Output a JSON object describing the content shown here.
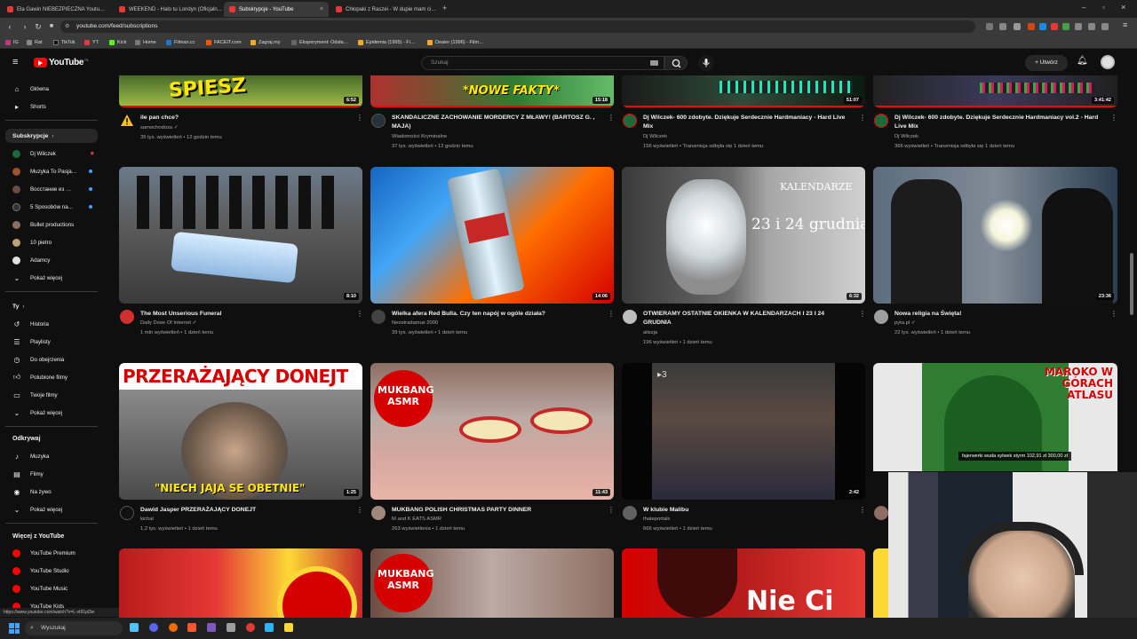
{
  "browser": {
    "tabs": [
      {
        "title": "Ela Gawin NIEBEZPIECZNA Youtu…"
      },
      {
        "title": "WEEKEND - Halo tu Londyn (Oficjaln…"
      },
      {
        "title": "Subskrypcje - YouTube",
        "close": "×"
      },
      {
        "title": "Chłopaki z Raszei - W dupie mam ci…"
      }
    ],
    "new_tab": "+",
    "url": "youtube.com/feed/subscriptions",
    "bookmarks": [
      "IG",
      "Rat",
      "TikTok",
      "YT",
      "Kick",
      "Home",
      "Filman.cc",
      "FACEIT.com",
      "Zagraj.my",
      "Eksperyment: Odsła…",
      "Epidemia (1995) - Fi…",
      "Dealer (1996) - Film…"
    ]
  },
  "youtube": {
    "logo_text": "YouTube",
    "logo_region": "PL",
    "search_placeholder": "Szukaj",
    "create_label": "Utwórz"
  },
  "sidebar": {
    "main": [
      {
        "label": "Główna",
        "icon": "home-icon"
      },
      {
        "label": "Shorts",
        "icon": "shorts-icon"
      }
    ],
    "subscriptions_header": "Subskrypcje",
    "subscriptions": [
      {
        "label": "Dj Wilczek",
        "color": "#1b6b3a",
        "live": true
      },
      {
        "label": "Muzyka To Pasja…",
        "color": "#a0522d"
      },
      {
        "label": "Восстание из …",
        "color": "#6d4c41"
      },
      {
        "label": "5 Sposobów na…",
        "color": "#303030",
        "dot": true
      },
      {
        "label": "Bullet productions",
        "color": "#8d6e63"
      },
      {
        "label": "10 pietro",
        "color": "#c0a070"
      },
      {
        "label": "Adamcy",
        "color": "#e0e0e0"
      },
      {
        "label": "Pokaż więcej",
        "icon": "chevron-down-icon"
      }
    ],
    "you_header": "Ty",
    "you": [
      {
        "label": "Historia",
        "icon": "history-icon"
      },
      {
        "label": "Playlisty",
        "icon": "playlist-icon"
      },
      {
        "label": "Do obejrzenia",
        "icon": "clock-icon"
      },
      {
        "label": "Polubione filmy",
        "icon": "thumbs-up-icon"
      },
      {
        "label": "Twoje filmy",
        "icon": "video-icon"
      },
      {
        "label": "Pokaż więcej",
        "icon": "chevron-down-icon"
      }
    ],
    "explore_header": "Odkrywaj",
    "explore": [
      {
        "label": "Muzyka",
        "icon": "music-icon"
      },
      {
        "label": "Filmy",
        "icon": "film-icon"
      },
      {
        "label": "Na żywo",
        "icon": "live-icon"
      },
      {
        "label": "Pokaż więcej",
        "icon": "chevron-down-icon"
      }
    ],
    "more_header": "Więcej z YouTube",
    "more": [
      {
        "label": "YouTube Premium"
      },
      {
        "label": "YouTube Studio"
      },
      {
        "label": "YouTube Music"
      },
      {
        "label": "YouTube Kids"
      }
    ]
  },
  "videos": [
    {
      "title": "ile pan chce?",
      "channel": "samochodoza",
      "meta": "35 tys. wyświetleń • 12 godzin temu",
      "duration": "6:52",
      "overlay": "SPIESZ",
      "verified": true
    },
    {
      "title": "SKANDALICZNE ZACHOWANIE MORDERCY Z MŁAWY! (BARTOSZ G. , MAJA)",
      "channel": "Wiadomości Kryminalne",
      "meta": "37 tys. wyświetleń • 12 godzin temu",
      "duration": "15:18",
      "overlay": "*NOWE FAKTY*"
    },
    {
      "title": "Dj Wilczek- 600 zdobyte. Dziękuje Serdecznie Hardmaniacy - Hard Live Mix",
      "channel": "Dj Wilczek",
      "meta": "156 wyświetleń • Transmisja odbyła się 1 dzień temu",
      "duration": "51:07"
    },
    {
      "title": "Dj Wilczek- 600 zdobyte. Dziękuje Serdecznie Hardmaniacy vol.2 - Hard Live Mix",
      "channel": "Dj Wilczek",
      "meta": "366 wyświetleń • Transmisja odbyła się 1 dzień temu",
      "duration": "3:41:42"
    },
    {
      "title": "The Most Unserious Funeral",
      "channel": "Daily Dose Of Internet",
      "meta": "1 mln wyświetleń • 1 dzień temu",
      "duration": "8:10",
      "verified": true
    },
    {
      "title": "Wielka afera Red Bulla. Czy ten napój w ogóle działa?",
      "channel": "Neostradamus 2000",
      "meta": "39 tys. wyświetleń • 1 dzień temu",
      "duration": "14:06"
    },
    {
      "title": "OTWIERAMY OSTATNIE OKIENKA W KALENDARZACH I 23 I 24 GRUDNIA",
      "channel": "aliszja",
      "meta": "196 wyświetleń • 1 dzień temu",
      "duration": "6:32",
      "overlay": "KALENDARZE",
      "overlay2": "23 i 24 grudnia"
    },
    {
      "title": "Nowa religia na Święta!",
      "channel": "pyta.pl",
      "meta": "22 tys. wyświetleń • 1 dzień temu",
      "duration": "23:36",
      "verified": true
    },
    {
      "title": "Dawid Jasper PRZERAŻAJĄCY DONEJT",
      "channel": "kichal",
      "meta": "1,2 tys. wyświetleń • 1 dzień temu",
      "duration": "1:25",
      "overlay": "PRZERAŻAJĄCY DONEJT",
      "overlay2": "\"NIECH JAJA SE OBETNIE\""
    },
    {
      "title": "MUKBANG POLISH CHRISTMAS PARTY DINNER",
      "channel": "M and K EATS ASMR",
      "meta": "263 wyświetlenia • 1 dzień temu",
      "duration": "11:43",
      "overlay": "MUKBANG ASMR"
    },
    {
      "title": "W klubie Malibu",
      "channel": "thateportals",
      "meta": "666 wyświetleń • 1 dzień temu",
      "duration": "2:42"
    },
    {
      "title": "",
      "channel": "",
      "meta": "",
      "duration": "",
      "overlay": "MAROKO W GÓRACH ATLASU",
      "overlay2": "fajerwerki wuda sylwek styrm 102,91 zł  300,00 zł"
    },
    {
      "title": "",
      "channel": "",
      "meta": "",
      "duration": "",
      "overlay": ""
    },
    {
      "title": "",
      "channel": "",
      "meta": "",
      "duration": "",
      "overlay": "MUKBANG ASMR"
    },
    {
      "title": "",
      "channel": "",
      "meta": "",
      "duration": "",
      "overlay": "Nie Ci"
    }
  ],
  "status_url": "https://www.youtube.com/watch?v=L-vt91pl3w",
  "taskbar": {
    "search_placeholder": "Wyszukaj"
  }
}
